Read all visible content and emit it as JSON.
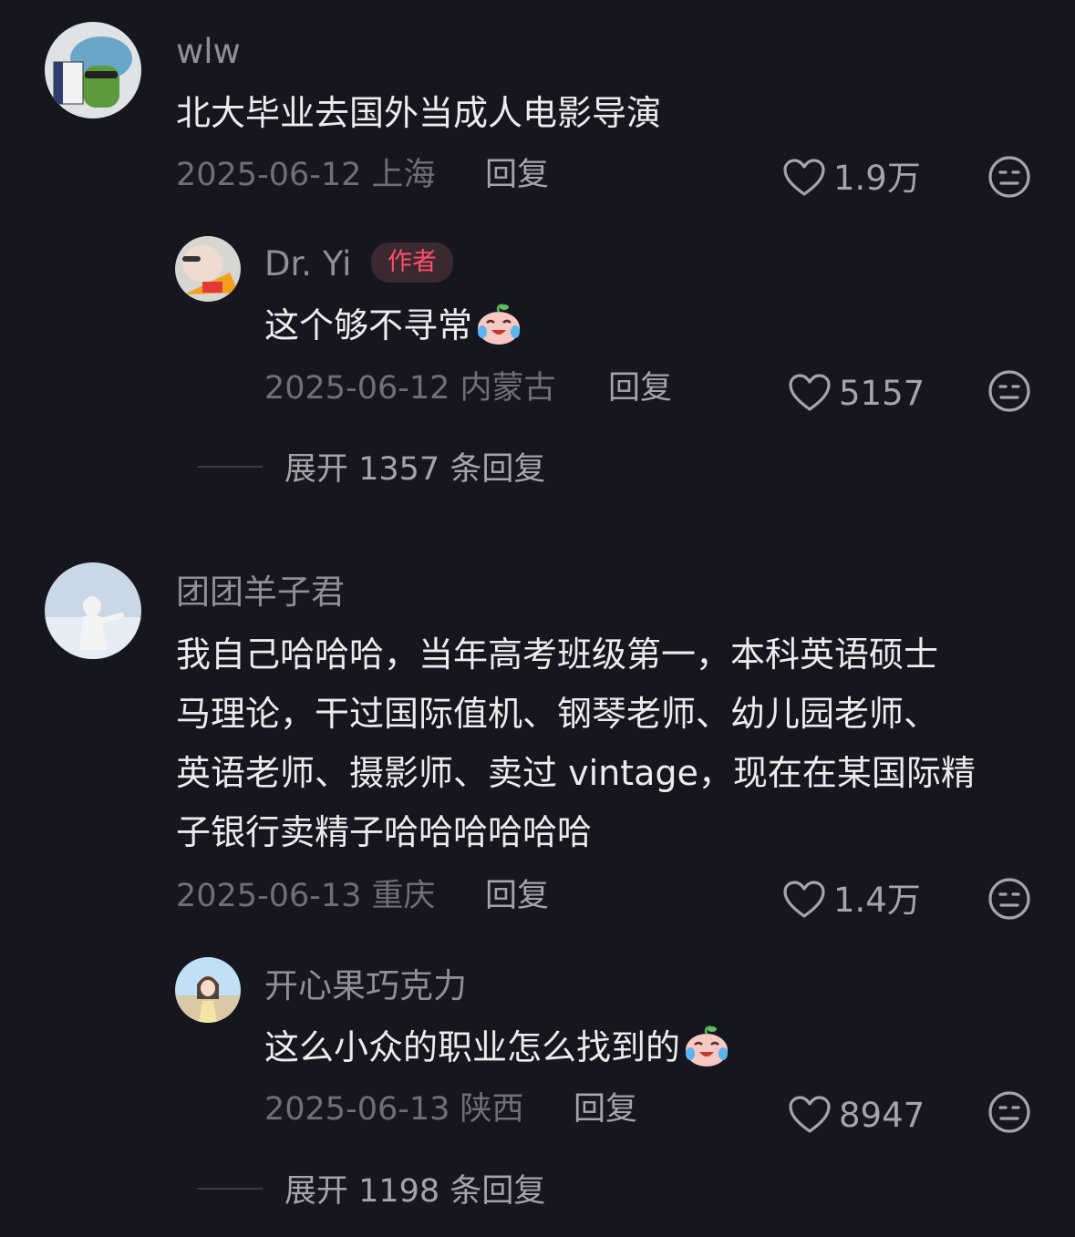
{
  "comments": [
    {
      "username": "wlw",
      "text": "北大毕业去国外当成人电影导演",
      "date_location": "2025-06-12 上海",
      "reply_label": "回复",
      "likes": "1.9万",
      "replies": [
        {
          "username": "Dr. Yi",
          "badge": "作者",
          "text": "这个够不寻常",
          "emoji": "crying-laughing-peach-emoji",
          "date_location": "2025-06-12 内蒙古",
          "reply_label": "回复",
          "likes": "5157"
        }
      ],
      "expand_label": "展开 1357 条回复"
    },
    {
      "username": "团团羊子君",
      "text_lines": [
        "我自己哈哈哈，当年高考班级第一，本科英语硕士",
        "马理论，干过国际值机、钢琴老师、幼儿园老师、",
        "英语老师、摄影师、卖过 vintage，现在在某国际精",
        "子银行卖精子哈哈哈哈哈哈"
      ],
      "date_location": "2025-06-13 重庆",
      "reply_label": "回复",
      "likes": "1.4万",
      "replies": [
        {
          "username": "开心果巧克力",
          "text": "这么小众的职业怎么找到的",
          "emoji": "crying-laughing-peach-emoji",
          "date_location": "2025-06-13 陕西",
          "reply_label": "回复",
          "likes": "8947"
        }
      ],
      "expand_label": "展开 1198 条回复"
    }
  ]
}
